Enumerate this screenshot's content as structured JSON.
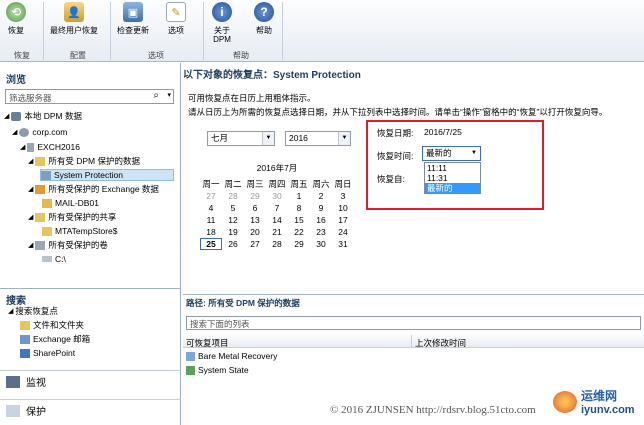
{
  "ribbon": {
    "buttons": [
      {
        "label": "恢复",
        "icon": "restore-icon"
      },
      {
        "label": "最终用户恢复",
        "icon": "end-user-recovery-icon"
      },
      {
        "label": "检查更新",
        "icon": "check-updates-icon"
      },
      {
        "label": "选项",
        "icon": "options-icon"
      },
      {
        "label": "关于",
        "label2": "DPM",
        "icon": "about-icon"
      },
      {
        "label": "帮助",
        "icon": "help-icon"
      }
    ],
    "groups": [
      "恢复",
      "配置",
      "选项",
      "帮助"
    ]
  },
  "left": {
    "browse_title": "浏览",
    "filter_placeholder": "筛选服务器",
    "tree": [
      "本地 DPM 数据",
      "corp.com",
      "EXCH2016",
      "所有受 DPM 保护的数据",
      "System Protection",
      "所有受保护的 Exchange 数据",
      "MAIL-DB01",
      "所有受保护的共享",
      "MTATempStore$",
      "所有受保护的卷",
      "C:\\"
    ],
    "search_title": "搜索",
    "search_items": [
      "搜索恢复点",
      "文件和文件夹",
      "Exchange 邮箱",
      "SharePoint"
    ],
    "workspaces": [
      "监视",
      "保护"
    ]
  },
  "right": {
    "title": "以下对象的恢复点：System Protection",
    "line1": "可用恢复点在日历上用粗体指示。",
    "line2": "请从日历上为所需的恢复点选择日期，并从下拉列表中选择时间。请单击“操作”窗格中的“恢复”以打开恢复向导。",
    "month_value": "七月",
    "year_value": "2016",
    "calendar": {
      "title": "2016年7月",
      "weekdays": [
        "周一",
        "周二",
        "周三",
        "周四",
        "周五",
        "周六",
        "周日"
      ],
      "weeks": [
        [
          "27",
          "28",
          "29",
          "30",
          "1",
          "2",
          "3"
        ],
        [
          "4",
          "5",
          "6",
          "7",
          "8",
          "9",
          "10"
        ],
        [
          "11",
          "12",
          "13",
          "14",
          "15",
          "16",
          "17"
        ],
        [
          "18",
          "19",
          "20",
          "21",
          "22",
          "23",
          "24"
        ],
        [
          "25",
          "26",
          "27",
          "28",
          "29",
          "30",
          "31"
        ]
      ]
    },
    "recovery_date_label": "恢复日期:",
    "recovery_date_value": "2016/7/25",
    "recovery_time_label": "恢复时间:",
    "recovery_time_value": "最新的",
    "recovery_from_label": "恢复自:",
    "time_options": [
      "11:11",
      "11:31",
      "最新的"
    ],
    "path_label": "路径: 所有受 DPM 保护的数据",
    "search_list_placeholder": "搜索下面的列表",
    "columns": [
      "可恢复项目",
      "上次修改时间"
    ],
    "rows": [
      "Bare Metal Recovery",
      "System State"
    ]
  },
  "watermark": {
    "copyright": "© 2016 ZJUNSEN http://rdsrv.blog.51cto.com",
    "site_name": "运维网",
    "site_url": "iyunv.com"
  },
  "colors": {
    "highlight": "#e11b2a",
    "selected": "#3399ff"
  }
}
